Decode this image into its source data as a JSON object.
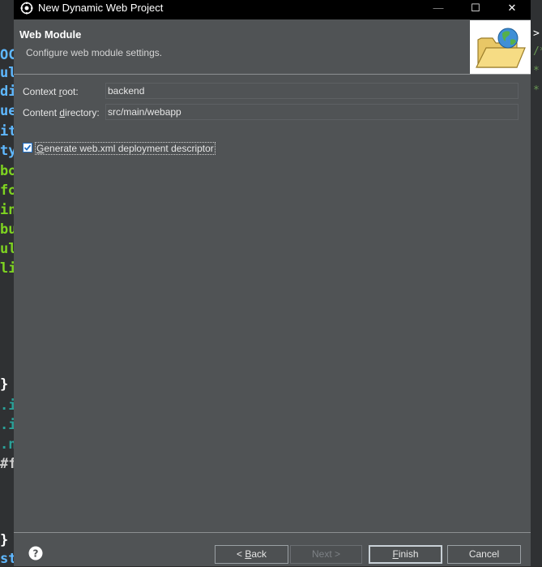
{
  "window": {
    "title": "New Dynamic Web Project",
    "controls": {
      "minimize": "—",
      "maximize": "☐",
      "close": "✕"
    }
  },
  "banner": {
    "heading": "Web Module",
    "description": "Configure web module settings.",
    "image_icon": "folder-globe-icon"
  },
  "form": {
    "context_root": {
      "label_pre": "Context ",
      "label_mnemonic": "r",
      "label_post": "oot:",
      "value": "backend"
    },
    "content_directory": {
      "label_pre": "Content ",
      "label_mnemonic": "d",
      "label_post": "irectory:",
      "value": "src/main/webapp"
    },
    "generate_web_xml": {
      "label_mnemonic": "G",
      "label_post": "enerate web.xml deployment descriptor",
      "checked": true
    }
  },
  "footer": {
    "help_icon": "help-icon",
    "back": {
      "mnemonic_pre": "< ",
      "mnemonic": "B",
      "post": "ack"
    },
    "next": {
      "label": "Next >"
    },
    "finish": {
      "mnemonic": "F",
      "post": "inish"
    },
    "cancel": {
      "label": "Cancel"
    }
  },
  "background_editor": {
    "left_lines": [
      "OCT",
      "ul",
      "di",
      "ue",
      "it",
      "ty",
      "bo",
      "fo",
      "in",
      "bu",
      "ul",
      "li",
      "}",
      ".i",
      ".i",
      ".n",
      "#f",
      "}",
      "st"
    ],
    "right_lines": [
      "> ",
      "/*",
      "*",
      "*"
    ]
  },
  "colors": {
    "dialog_bg": "#505355",
    "titlebar_bg": "#000000",
    "accent": "#1f6fc5"
  }
}
